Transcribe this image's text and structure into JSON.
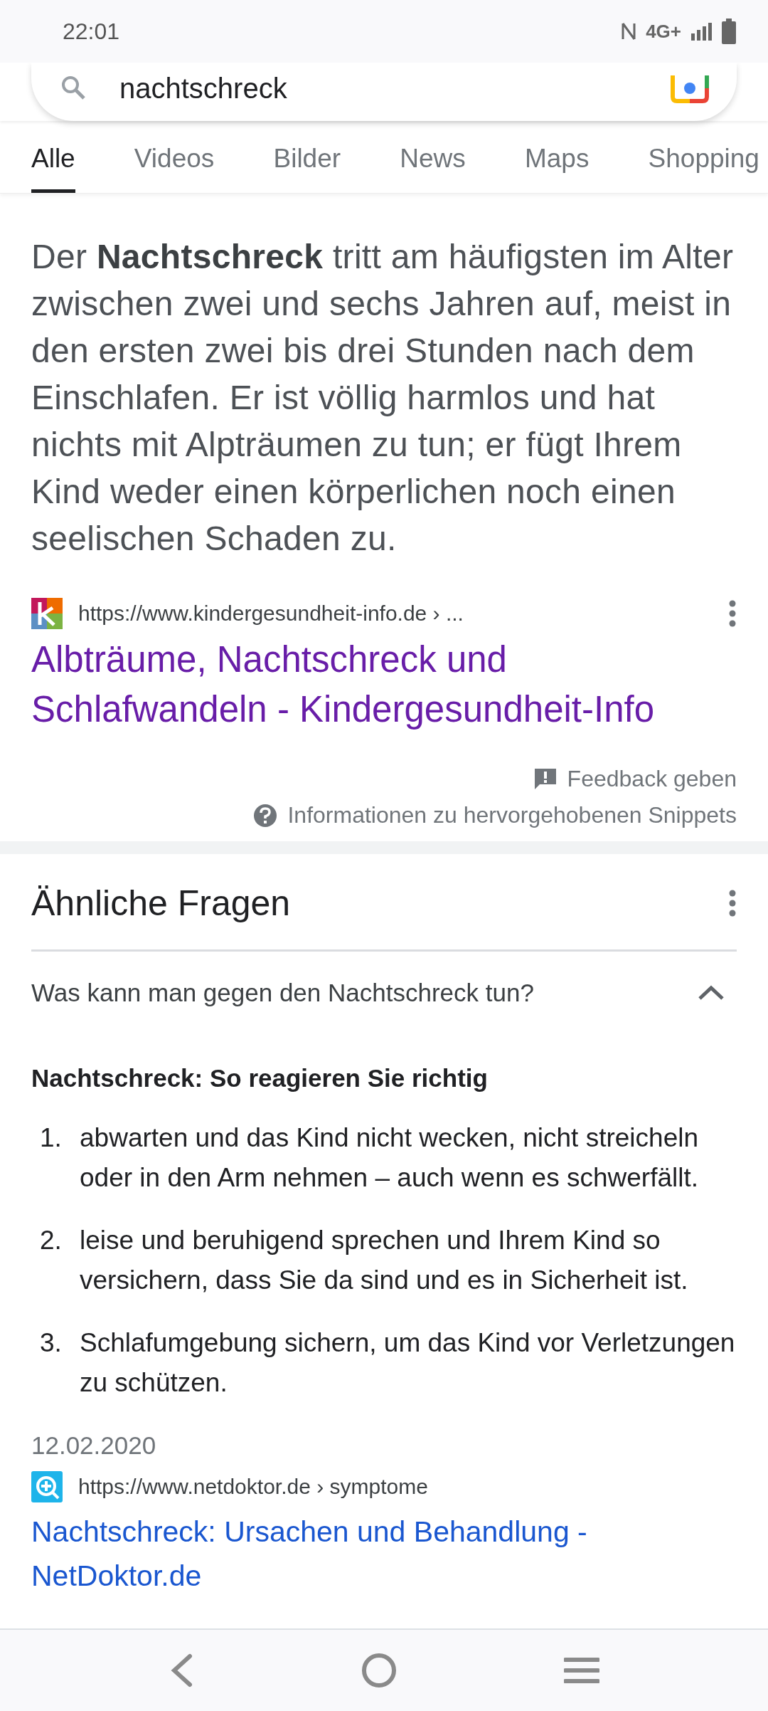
{
  "status_bar": {
    "time": "22:01",
    "network": "4G+"
  },
  "search": {
    "value": "nachtschreck"
  },
  "tabs": [
    {
      "label": "Alle",
      "selected": true
    },
    {
      "label": "Videos",
      "selected": false
    },
    {
      "label": "Bilder",
      "selected": false
    },
    {
      "label": "News",
      "selected": false
    },
    {
      "label": "Maps",
      "selected": false
    },
    {
      "label": "Shopping",
      "selected": false
    }
  ],
  "featured_snippet": {
    "text": "Der **Nachtschreck** tritt am häufigsten im Alter zwischen zwei und sechs Jahren auf, meist in den ersten zwei bis drei Stunden nach dem Einschlafen. Er ist völlig harmlos und hat nichts mit Alpträumen zu tun; er fügt Ihrem Kind weder einen körperlichen noch einen seelischen Schaden zu.",
    "source_url": "https://www.kindergesundheit-info.de › ...",
    "title": "Albträume, Nachtschreck und Schlafwandeln - Kindergesundheit-Info",
    "visited": true,
    "feedback": "Feedback geben",
    "info": "Informationen zu hervorgehobenen Snippets"
  },
  "related_questions": {
    "heading": "Ähnliche Fragen",
    "items": [
      {
        "question": "Was kann man gegen den Nachtschreck tun?",
        "expanded": true,
        "answer_heading": "Nachtschreck: So reagieren Sie richtig",
        "answer_list": [
          {
            "number": "1.",
            "text": "abwarten und das Kind nicht wecken, nicht streicheln oder in den Arm nehmen – auch wenn es schwerfällt."
          },
          {
            "number": "2.",
            "text": "leise und beruhigend sprechen und Ihrem Kind so versichern, dass Sie da sind und es in Sicherheit ist."
          },
          {
            "number": "3.",
            "text": "Schlafumgebung sichern, um das Kind vor Verletzungen zu schützen."
          }
        ],
        "date": "12.02.2020",
        "source_url": "https://www.netdoktor.de › symptome",
        "title": "Nachtschreck: Ursachen und Behandlung - NetDoktor.de",
        "visited": false
      }
    ]
  }
}
